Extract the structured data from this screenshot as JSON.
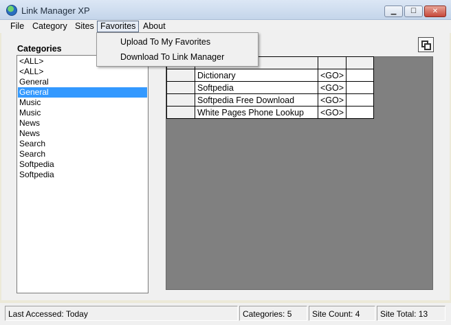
{
  "window": {
    "title": "Link Manager XP",
    "min_symbol": "▁",
    "max_symbol": "☐",
    "close_symbol": "✕"
  },
  "menu": {
    "items": [
      "File",
      "Category",
      "Sites",
      "Favorites",
      "About"
    ],
    "active": "Favorites"
  },
  "favorites_menu": {
    "items": [
      "Upload To My Favorites",
      "Download To Link Manager"
    ]
  },
  "categories": {
    "label": "Categories",
    "items": [
      "<ALL>",
      "<ALL>",
      "General",
      "General",
      "Music",
      "Music",
      "News",
      "News",
      "Search",
      "Search",
      "Softpedia",
      "Softpedia"
    ],
    "selected_index": 3
  },
  "sites": {
    "rows": [
      {
        "name": "Dictionary",
        "go": "<GO>"
      },
      {
        "name": "Softpedia",
        "go": "<GO>"
      },
      {
        "name": "Softpedia Free Download",
        "go": "<GO>"
      },
      {
        "name": "White Pages Phone Lookup",
        "go": "<GO>"
      }
    ]
  },
  "status": {
    "last_accessed": "Last Accessed: Today",
    "categories": "Categories: 5",
    "site_count": "Site Count: 4",
    "site_total": "Site Total: 13"
  },
  "colors": {
    "selection": "#3399ff",
    "grid_background": "#808080"
  }
}
